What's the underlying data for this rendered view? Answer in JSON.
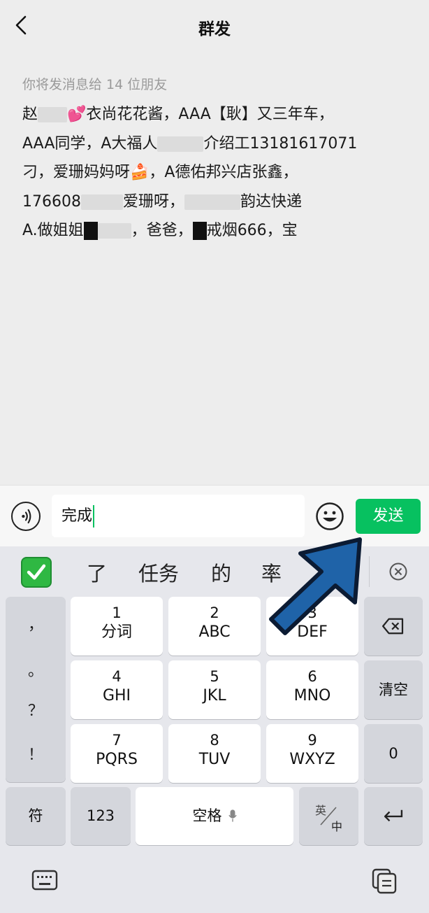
{
  "header": {
    "title": "群发"
  },
  "message": {
    "recipients_label": "你将发消息给 14 位朋友",
    "lines": [
      [
        "赵",
        "💕衣尚花花酱，AAA【耿】又三年车，"
      ],
      [
        "AAA同学，A大福人",
        "介绍工13181617071"
      ],
      [
        "刁，爱珊妈妈呀🍰，A德佑邦兴店张鑫，"
      ],
      [
        "176608",
        "爱珊呀，",
        "韵达快递"
      ],
      [
        "A.做姐姐",
        "，爸爸，",
        "戒烟666，宝"
      ]
    ]
  },
  "input": {
    "value": "完成",
    "send_label": "发送"
  },
  "candidates": [
    "了",
    "任务",
    "的",
    "率"
  ],
  "keys": {
    "k1": {
      "num": "1",
      "let": "分词"
    },
    "k2": {
      "num": "2",
      "let": "ABC"
    },
    "k3": {
      "num": "3",
      "let": "DEF"
    },
    "k4": {
      "num": "4",
      "let": "GHI"
    },
    "k5": {
      "num": "5",
      "let": "JKL"
    },
    "k6": {
      "num": "6",
      "let": "MNO"
    },
    "k7": {
      "num": "7",
      "let": "PQRS"
    },
    "k8": {
      "num": "8",
      "let": "TUV"
    },
    "k9": {
      "num": "9",
      "let": "WXYZ"
    },
    "clear": "清空",
    "zero": "0",
    "symbols": "符",
    "num123": "123",
    "space": "空格",
    "lang_top": "英",
    "lang_bottom": "中"
  },
  "punctuation": [
    "，",
    "。",
    "？",
    "！"
  ],
  "colors": {
    "accent": "#07c160",
    "arrow": "#1f63a8"
  }
}
